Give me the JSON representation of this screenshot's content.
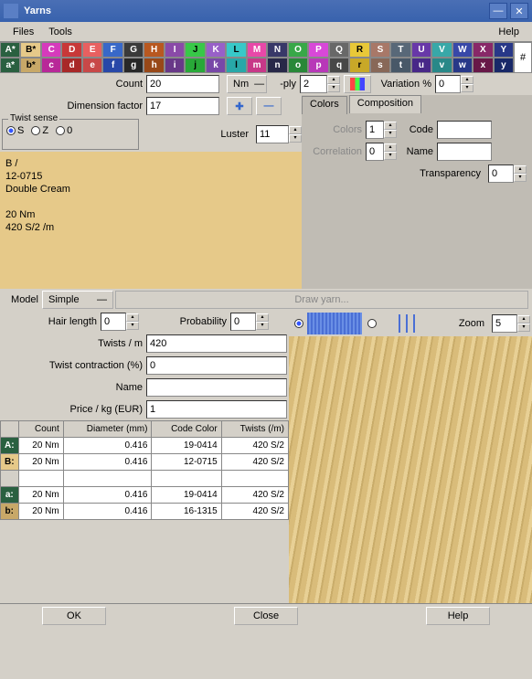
{
  "window": {
    "title": "Yarns"
  },
  "menu": {
    "files": "Files",
    "tools": "Tools",
    "help": "Help"
  },
  "palette": {
    "row1": [
      {
        "l": "A*",
        "bg": "#2a6040",
        "fg": "#fff"
      },
      {
        "l": "B*",
        "bg": "#e6c989",
        "fg": "#000"
      },
      {
        "l": "C",
        "bg": "#d63abc",
        "fg": "#fff"
      },
      {
        "l": "D",
        "bg": "#c83838",
        "fg": "#fff"
      },
      {
        "l": "E",
        "bg": "#e86060",
        "fg": "#fff"
      },
      {
        "l": "F",
        "bg": "#3868c8",
        "fg": "#fff"
      },
      {
        "l": "G",
        "bg": "#3a3a3a",
        "fg": "#fff"
      },
      {
        "l": "H",
        "bg": "#b85820",
        "fg": "#fff"
      },
      {
        "l": "I",
        "bg": "#8a4aa8",
        "fg": "#fff"
      },
      {
        "l": "J",
        "bg": "#38c848",
        "fg": "#000"
      },
      {
        "l": "K",
        "bg": "#9860c8",
        "fg": "#fff"
      },
      {
        "l": "L",
        "bg": "#38c8c8",
        "fg": "#000"
      },
      {
        "l": "M",
        "bg": "#e848a8",
        "fg": "#fff"
      },
      {
        "l": "N",
        "bg": "#383868",
        "fg": "#fff"
      },
      {
        "l": "O",
        "bg": "#38a848",
        "fg": "#fff"
      },
      {
        "l": "P",
        "bg": "#d848d8",
        "fg": "#fff"
      },
      {
        "l": "Q",
        "bg": "#686868",
        "fg": "#fff"
      },
      {
        "l": "R",
        "bg": "#e8c838",
        "fg": "#000"
      },
      {
        "l": "S",
        "bg": "#a87868",
        "fg": "#fff"
      },
      {
        "l": "T",
        "bg": "#586878",
        "fg": "#fff"
      },
      {
        "l": "U",
        "bg": "#6838a8",
        "fg": "#fff"
      },
      {
        "l": "V",
        "bg": "#38a8a8",
        "fg": "#fff"
      },
      {
        "l": "W",
        "bg": "#3848a8",
        "fg": "#fff"
      },
      {
        "l": "X",
        "bg": "#882868",
        "fg": "#fff"
      },
      {
        "l": "Y",
        "bg": "#283888",
        "fg": "#fff"
      }
    ],
    "row2": [
      {
        "l": "a*",
        "bg": "#2a6040",
        "fg": "#fff"
      },
      {
        "l": "b*",
        "bg": "#c8a868",
        "fg": "#000"
      },
      {
        "l": "c",
        "bg": "#b82898",
        "fg": "#fff"
      },
      {
        "l": "d",
        "bg": "#a82828",
        "fg": "#fff"
      },
      {
        "l": "e",
        "bg": "#c84848",
        "fg": "#fff"
      },
      {
        "l": "f",
        "bg": "#2848a8",
        "fg": "#fff"
      },
      {
        "l": "g",
        "bg": "#282828",
        "fg": "#fff"
      },
      {
        "l": "h",
        "bg": "#984818",
        "fg": "#fff"
      },
      {
        "l": "i",
        "bg": "#683888",
        "fg": "#fff"
      },
      {
        "l": "j",
        "bg": "#28a838",
        "fg": "#000"
      },
      {
        "l": "k",
        "bg": "#7848a8",
        "fg": "#fff"
      },
      {
        "l": "l",
        "bg": "#28a8a8",
        "fg": "#000"
      },
      {
        "l": "m",
        "bg": "#c83888",
        "fg": "#fff"
      },
      {
        "l": "n",
        "bg": "#282848",
        "fg": "#fff"
      },
      {
        "l": "o",
        "bg": "#288838",
        "fg": "#fff"
      },
      {
        "l": "p",
        "bg": "#b838b8",
        "fg": "#fff"
      },
      {
        "l": "q",
        "bg": "#484848",
        "fg": "#fff"
      },
      {
        "l": "r",
        "bg": "#c8a828",
        "fg": "#000"
      },
      {
        "l": "s",
        "bg": "#886858",
        "fg": "#fff"
      },
      {
        "l": "t",
        "bg": "#485868",
        "fg": "#fff"
      },
      {
        "l": "u",
        "bg": "#482888",
        "fg": "#fff"
      },
      {
        "l": "v",
        "bg": "#288888",
        "fg": "#fff"
      },
      {
        "l": "w",
        "bg": "#283888",
        "fg": "#fff"
      },
      {
        "l": "x",
        "bg": "#681848",
        "fg": "#fff"
      },
      {
        "l": "y",
        "bg": "#182868",
        "fg": "#fff"
      }
    ],
    "hash": "#"
  },
  "count": {
    "label": "Count",
    "value": "20",
    "unit_label": "Nm",
    "ply_label": "-ply",
    "ply_value": "2",
    "variation_label": "Variation %",
    "variation_value": "0"
  },
  "dim": {
    "label": "Dimension factor",
    "value": "17"
  },
  "twist": {
    "legend": "Twist sense",
    "s": "S",
    "z": "Z",
    "zero": "0"
  },
  "luster": {
    "label": "Luster",
    "value": "11"
  },
  "tabs": {
    "colors": "Colors",
    "composition": "Composition"
  },
  "colors_panel": {
    "colors_label": "Colors",
    "colors_value": "1",
    "code_label": "Code",
    "code_value": "",
    "correlation_label": "Correlation",
    "correlation_value": "0",
    "name_label": "Name",
    "name_value": "",
    "transparency_label": "Transparency",
    "transparency_value": "0"
  },
  "swatch": {
    "line1": "B                     /",
    "line2": "12-0715",
    "line3": "Double Cream",
    "line4": "20 Nm",
    "line5": "420 S/2 /m"
  },
  "model": {
    "label": "Model",
    "value": "Simple",
    "draw": "Draw yarn..."
  },
  "hair": {
    "label": "Hair length",
    "value": "0",
    "prob_label": "Probability",
    "prob_value": "0"
  },
  "zoom": {
    "label": "Zoom",
    "value": "5"
  },
  "twists_m": {
    "label": "Twists / m",
    "value": "420"
  },
  "contraction": {
    "label": "Twist contraction (%)",
    "value": "0"
  },
  "name_field": {
    "label": "Name",
    "value": ""
  },
  "price": {
    "label": "Price / kg (EUR)",
    "value": "1"
  },
  "table": {
    "headers": [
      "Count",
      "Diameter (mm)",
      "Code Color",
      "Twists (/m)"
    ],
    "rows": [
      {
        "hdr": "A:",
        "bg": "#2a6040",
        "cells": [
          "20 Nm",
          "0.416",
          "19-0414",
          "420 S/2"
        ]
      },
      {
        "hdr": "B:",
        "bg": "#e6c989",
        "cells": [
          "20 Nm",
          "0.416",
          "12-0715",
          "420 S/2"
        ]
      },
      {
        "hdr": "",
        "bg": "",
        "cells": [
          "",
          "",
          "",
          ""
        ]
      },
      {
        "hdr": "a:",
        "bg": "#2a6040",
        "cells": [
          "20 Nm",
          "0.416",
          "19-0414",
          "420 S/2"
        ]
      },
      {
        "hdr": "b:",
        "bg": "#c8a868",
        "cells": [
          "20 Nm",
          "0.416",
          "16-1315",
          "420 S/2"
        ]
      }
    ]
  },
  "footer": {
    "ok": "OK",
    "close": "Close",
    "help": "Help"
  }
}
